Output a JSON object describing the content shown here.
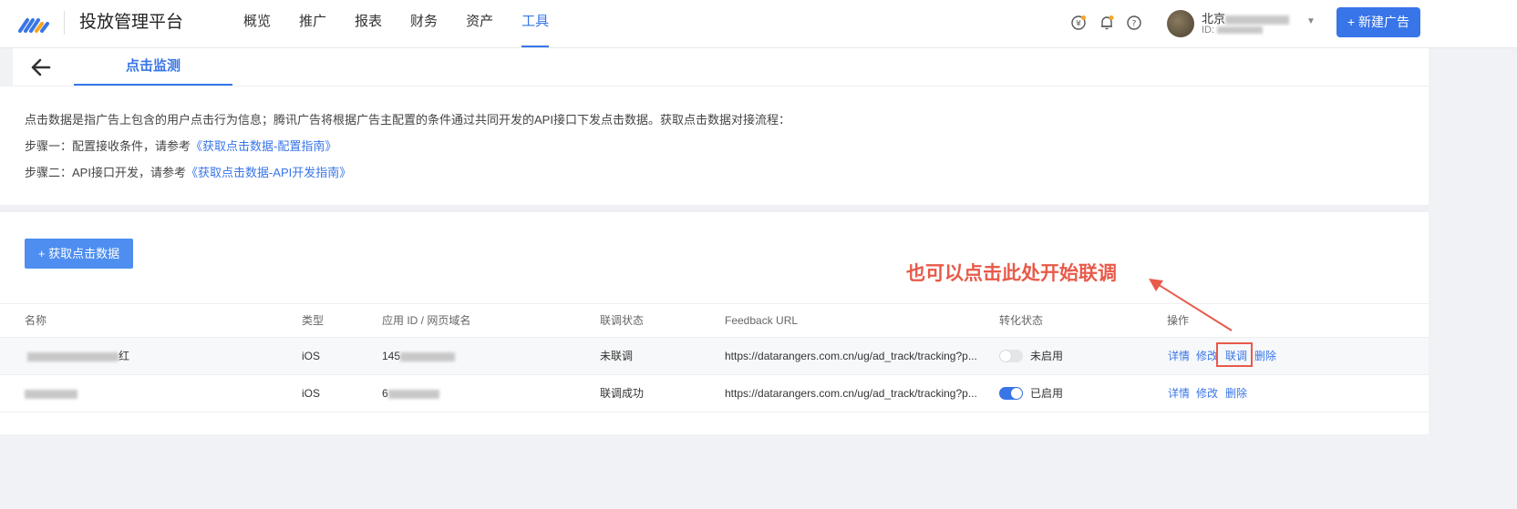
{
  "header": {
    "brand": "投放管理平台",
    "nav": [
      "概览",
      "推广",
      "报表",
      "财务",
      "资产",
      "工具"
    ],
    "active_nav_index": 5,
    "account_name": "北京",
    "account_id_label": "ID:",
    "new_ad_button": "+ 新建广告",
    "icons": [
      "coin-icon",
      "bell-icon",
      "help-icon"
    ],
    "accent_color": "#3875e8"
  },
  "tabbar": {
    "tab_label": "点击监测"
  },
  "info": {
    "line1": "点击数据是指广告上包含的用户点击行为信息；腾讯广告将根据广告主配置的条件通过共同开发的API接口下发点击数据。获取点击数据对接流程：",
    "step1_prefix": "步骤一：配置接收条件，请参考",
    "step1_link": "《获取点击数据-配置指南》",
    "step2_prefix": "步骤二：API接口开发，请参考",
    "step2_link": "《获取点击数据-API开发指南》"
  },
  "main": {
    "get_button": "+ 获取点击数据",
    "annotation": "也可以点击此处开始联调",
    "annotation_color": "#e85a4a"
  },
  "table": {
    "headers": [
      "名称",
      "类型",
      "应用 ID / 网页域名",
      "联调状态",
      "Feedback URL",
      "转化状态",
      "操作"
    ],
    "rows": [
      {
        "name_suffix": "红",
        "type": "iOS",
        "app_id_prefix": "145",
        "debug_status": "未联调",
        "feedback_url": "https://datarangers.com.cn/ug/ad_track/tracking?p...",
        "conversion_enabled": false,
        "conversion_label": "未启用",
        "ops": [
          "详情",
          "修改",
          "联调",
          "删除"
        ]
      },
      {
        "name_suffix": "",
        "type": "iOS",
        "app_id_prefix": "6",
        "debug_status": "联调成功",
        "feedback_url": "https://datarangers.com.cn/ug/ad_track/tracking?p...",
        "conversion_enabled": true,
        "conversion_label": "已启用",
        "ops": [
          "详情",
          "修改",
          "删除"
        ]
      }
    ]
  }
}
